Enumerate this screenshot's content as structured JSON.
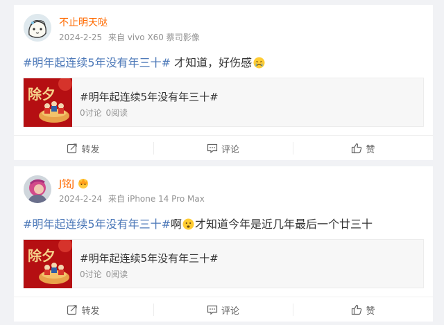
{
  "posts": [
    {
      "author": "不止明天哒",
      "date": "2024-2-25",
      "source": "来自 vivo X60 蔡司影像",
      "hashtag": "#明年起连续5年没有年三十#",
      "text": " 才知道，好伤感",
      "emoji": "crying-face-emoji",
      "topic": {
        "title": "#明年起连续5年没有年三十#",
        "discuss": "0讨论",
        "read": "0阅读",
        "thumb_text": "除夕"
      },
      "actions": {
        "repost": "转发",
        "comment": "评论",
        "like": "赞"
      }
    },
    {
      "author": "J铭J",
      "date": "2024-2-24",
      "source": "来自 iPhone 14 Pro Max",
      "hashtag": "#明年起连续5年没有年三十#",
      "text_before": "啊",
      "text": "才知道今年是近几年最后一个廿三十",
      "emoji": "frowning-face-emoji",
      "topic": {
        "title": "#明年起连续5年没有年三十#",
        "discuss": "0讨论",
        "read": "0阅读",
        "thumb_text": "除夕"
      },
      "actions": {
        "repost": "转发",
        "comment": "评论",
        "like": "赞"
      }
    }
  ],
  "colors": {
    "author": "#ff6a00",
    "hashtag": "#4c78b8",
    "thumb_red": "#b50f12"
  }
}
